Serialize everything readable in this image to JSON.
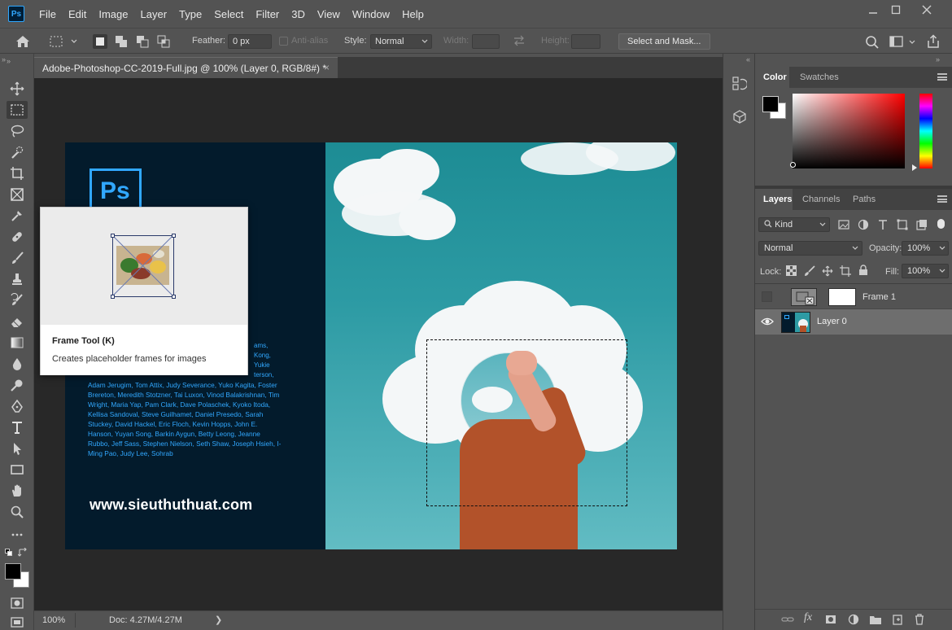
{
  "menubar": {
    "logo": "Ps",
    "items": [
      "File",
      "Edit",
      "Image",
      "Layer",
      "Type",
      "Select",
      "Filter",
      "3D",
      "View",
      "Window",
      "Help"
    ]
  },
  "options": {
    "feather_label": "Feather:",
    "feather_value": "0 px",
    "antialias_label": "Anti-alias",
    "style_label": "Style:",
    "style_value": "Normal",
    "width_label": "Width:",
    "height_label": "Height:",
    "select_mask_label": "Select and Mask..."
  },
  "document": {
    "tab_title": "Adobe-Photoshop-CC-2019-Full.jpg @ 100% (Layer 0, RGB/8#) *",
    "splash_logo": "Ps",
    "credits_visible": "Adam Jerugim, Tom Attix, Judy Severance, Yuko Kagita, Foster Brereton, Meredith Stotzner, Tai Luxon, Vinod Balakrishnan, Tim Wright, Maria Yap, Pam Clark, Dave Polaschek, Kyoko Itoda, Kellisa Sandoval, Steve Guilhamet, Daniel Presedo, Sarah Stuckey, David Hackel, Eric Floch, Kevin Hopps, John E. Hanson, Yuyan Song, Barkin Aygun, Betty Leong, Jeanne Rubbo, Jeff Sass, Stephen Nielson, Seth Shaw, Joseph Hsieh, I-Ming Pao, Judy Lee, Sohrab",
    "credits_partial": [
      "ams,",
      "Kong,",
      "Yukie",
      "terson,"
    ],
    "website": "www.sieuthuthuat.com"
  },
  "tooltip": {
    "title": "Frame Tool (K)",
    "description": "Creates placeholder frames for images"
  },
  "status": {
    "zoom": "100%",
    "doc": "Doc: 4.27M/4.27M"
  },
  "color_panel": {
    "tabs": [
      "Color",
      "Swatches"
    ],
    "foreground": "#000000",
    "background": "#ffffff",
    "hue_color": "#ff0000"
  },
  "layers_panel": {
    "tabs": [
      "Layers",
      "Channels",
      "Paths"
    ],
    "filter_kind": "Kind",
    "blend_mode": "Normal",
    "opacity_label": "Opacity:",
    "opacity_value": "100%",
    "lock_label": "Lock:",
    "fill_label": "Fill:",
    "fill_value": "100%",
    "layers": [
      {
        "name": "Frame 1",
        "visible": false
      },
      {
        "name": "Layer 0",
        "visible": true,
        "selected": true
      }
    ]
  },
  "colors": {
    "accent": "#31a8ff",
    "app_bg": "#535353",
    "canvas_bg": "#282828"
  }
}
